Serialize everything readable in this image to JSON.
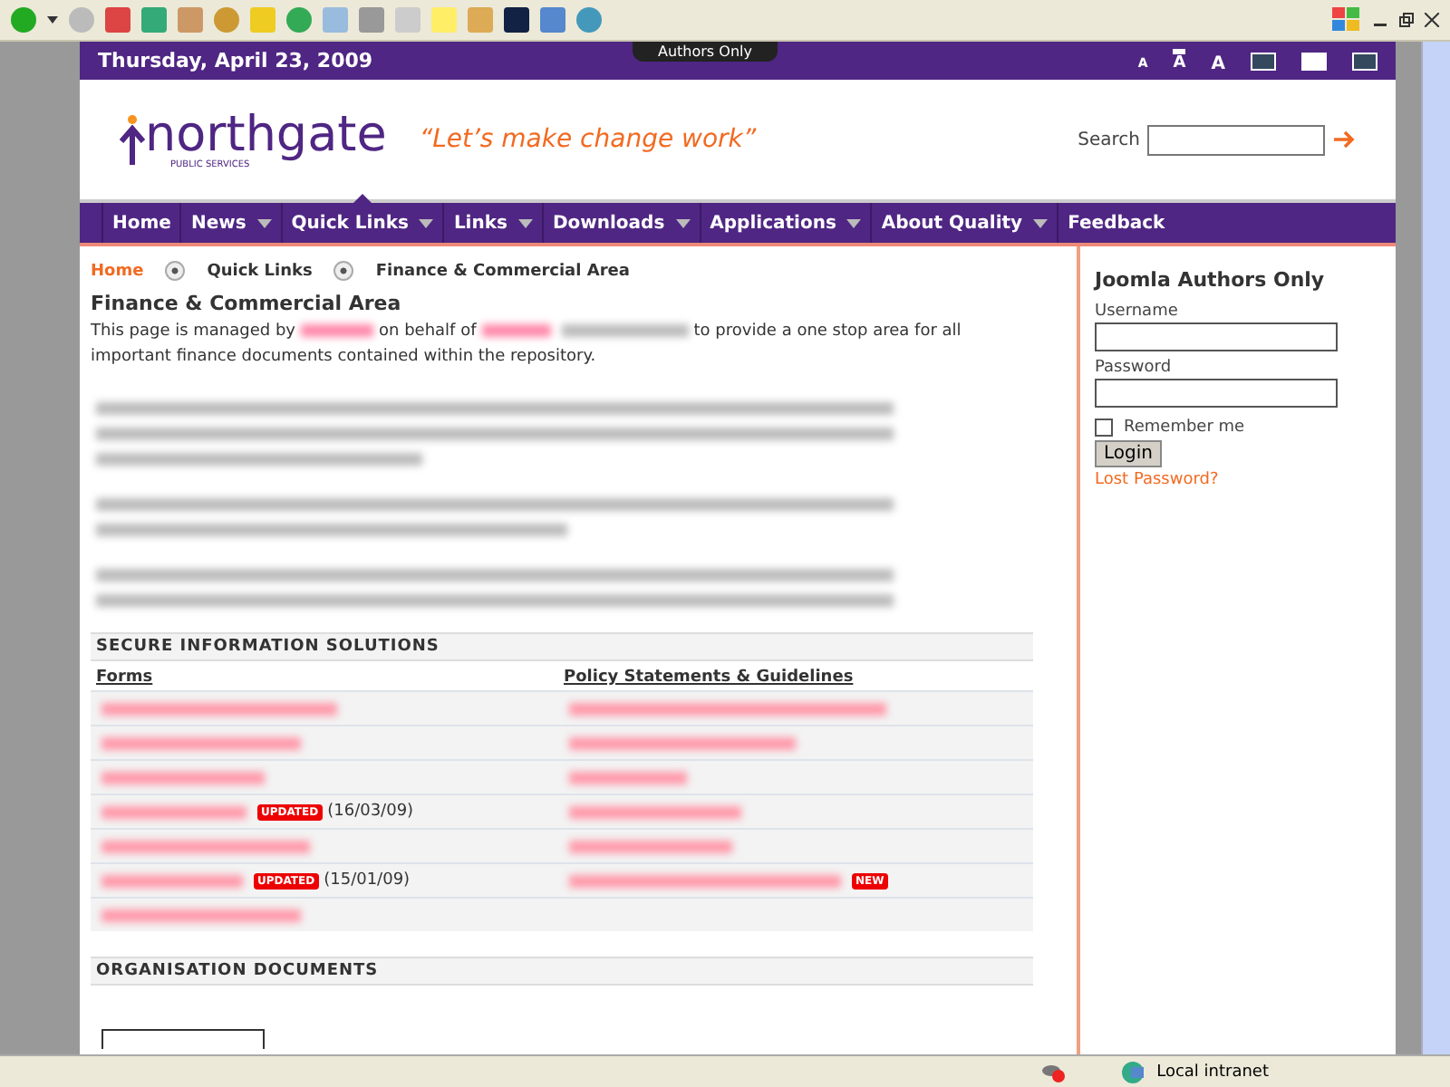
{
  "topbar": {
    "date": "Thursday, April 23, 2009",
    "authors_tab": "Authors Only",
    "font_sizes": [
      {
        "label": "A",
        "selected": false
      },
      {
        "label": "A",
        "selected": true
      },
      {
        "label": "A",
        "selected": false
      }
    ],
    "widths": [
      {
        "selected": false
      },
      {
        "selected": true
      },
      {
        "selected": false
      }
    ]
  },
  "header": {
    "logo": "northgate",
    "logo_sub": "PUBLIC SERVICES",
    "tagline": "“Let’s make change work”",
    "search_label": "Search"
  },
  "nav": [
    {
      "label": "Home",
      "dropdown": false,
      "selected": false
    },
    {
      "label": "News",
      "dropdown": true,
      "selected": false
    },
    {
      "label": "Quick Links",
      "dropdown": true,
      "selected": true
    },
    {
      "label": "Links",
      "dropdown": true,
      "selected": false
    },
    {
      "label": "Downloads",
      "dropdown": true,
      "selected": false
    },
    {
      "label": "Applications",
      "dropdown": true,
      "selected": false
    },
    {
      "label": "About Quality",
      "dropdown": true,
      "selected": false
    },
    {
      "label": "Feedback",
      "dropdown": false,
      "selected": false
    }
  ],
  "breadcrumb": [
    "Home",
    "Quick Links",
    "Finance & Commercial Area"
  ],
  "heading": "Finance & Commercial Area",
  "intro": {
    "before": "This page is managed by",
    "mid": "on behalf of",
    "after": "to provide a one stop area for all important finance documents contained within the repository."
  },
  "section": {
    "title": "SECURE INFORMATION SOLUTIONS",
    "columns": [
      "Forms",
      "Policy Statements & Guidelines"
    ],
    "rows": [
      {},
      {},
      {},
      {
        "badge": "UPDATED",
        "date": "(16/03/09)"
      },
      {},
      {
        "badge": "UPDATED",
        "date": "(15/01/09)",
        "right_badge": "NEW"
      },
      {
        "right_empty": true
      }
    ]
  },
  "section2": {
    "title": "ORGANISATION DOCUMENTS"
  },
  "login": {
    "title": "Joomla Authors Only",
    "username_label": "Username",
    "password_label": "Password",
    "remember": {
      "label": "Remember me",
      "checked": false
    },
    "button": "Login",
    "lost": "Lost Password?"
  },
  "status_bar": {
    "zone": "Local intranet"
  }
}
